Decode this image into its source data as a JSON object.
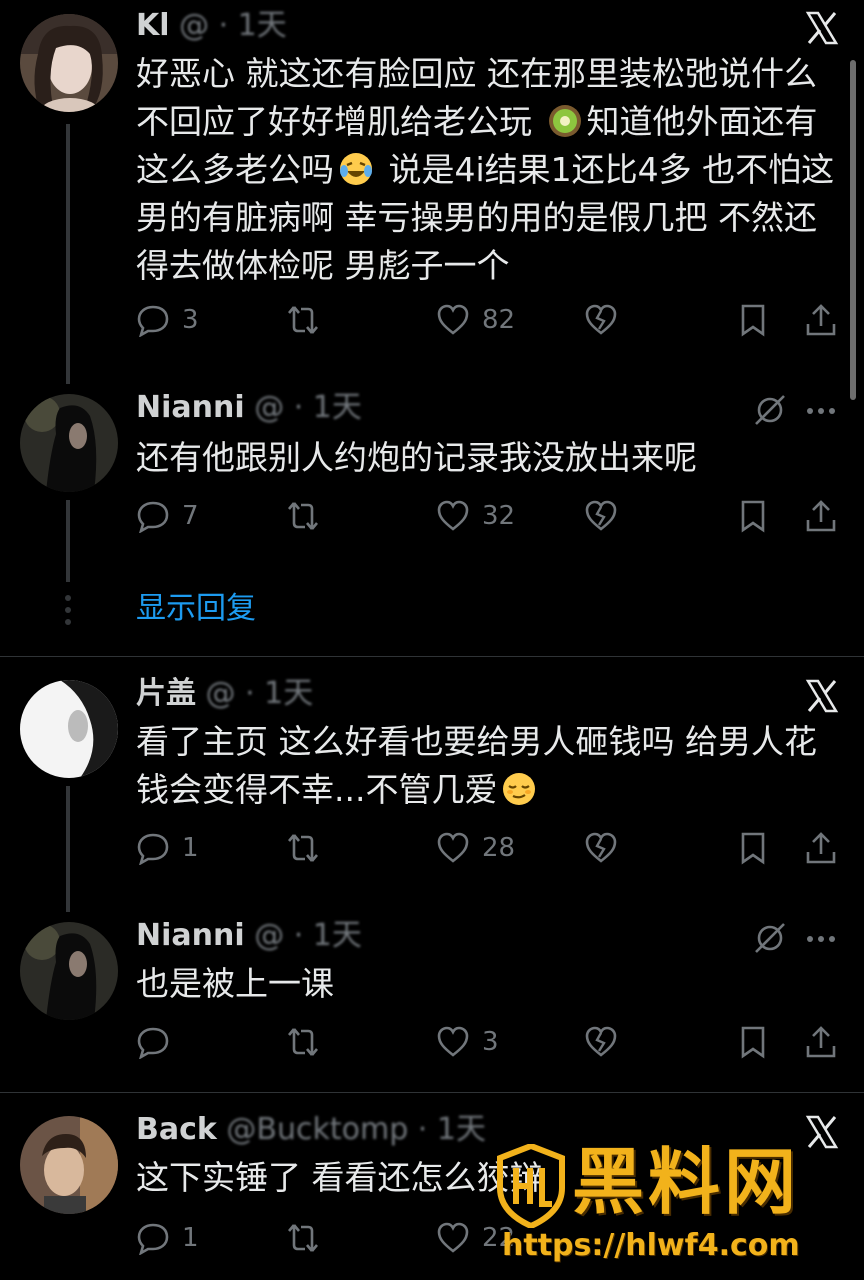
{
  "colors": {
    "background": "#000000",
    "text": "#e7e9ea",
    "muted": "#71767b",
    "link": "#1d9bf0",
    "divider": "#2f3336",
    "watermark": "#f2b21b"
  },
  "tweets": [
    {
      "username": "Kl",
      "handle_time": "@ · 1天",
      "text_parts": [
        "好恶心 就这还有脸回应 还在那里装松弛说什么不回应了好好增肌给老公玩 ",
        "知道他外面还有这么多老公吗",
        " 说是4i结果1还比4多 也不怕这男的有脏病啊 幸亏操男的用的是假几把 不然还得去做体检呢 男彪子一个"
      ],
      "emojis": [
        "kiwi-emoji",
        "laughing-tears-emoji"
      ],
      "replies": "3",
      "likes": "82",
      "top_icon": "x-close-icon"
    },
    {
      "username": "Nianni",
      "handle_time": "@ · 1天",
      "text": "还有他跟别人约炮的记录我没放出来呢",
      "replies": "7",
      "likes": "32",
      "top_icon": "mute-icon"
    },
    {
      "username": "片盖",
      "handle_time": "@ · 1天",
      "text_parts": [
        "看了主页 这么好看也要给男人砸钱吗 给男人花钱会变得不幸...不管几爱",
        ""
      ],
      "emojis": [
        "relieved-face-emoji"
      ],
      "replies": "1",
      "likes": "28",
      "top_icon": "x-close-icon"
    },
    {
      "username": "Nianni",
      "handle_time": "@ · 1天",
      "text": "也是被上一课",
      "replies": "",
      "likes": "3",
      "top_icon": "mute-icon"
    },
    {
      "username": "Back",
      "handle_time": "@Bucktomp · 1天",
      "text": "这下实锤了 看看还怎么狡辩",
      "replies": "1",
      "likes": "22",
      "top_icon": "x-close-icon"
    }
  ],
  "show_replies_label": "显示回复",
  "watermark": {
    "title": "黑料网",
    "url": "https://hlwf4.com"
  }
}
